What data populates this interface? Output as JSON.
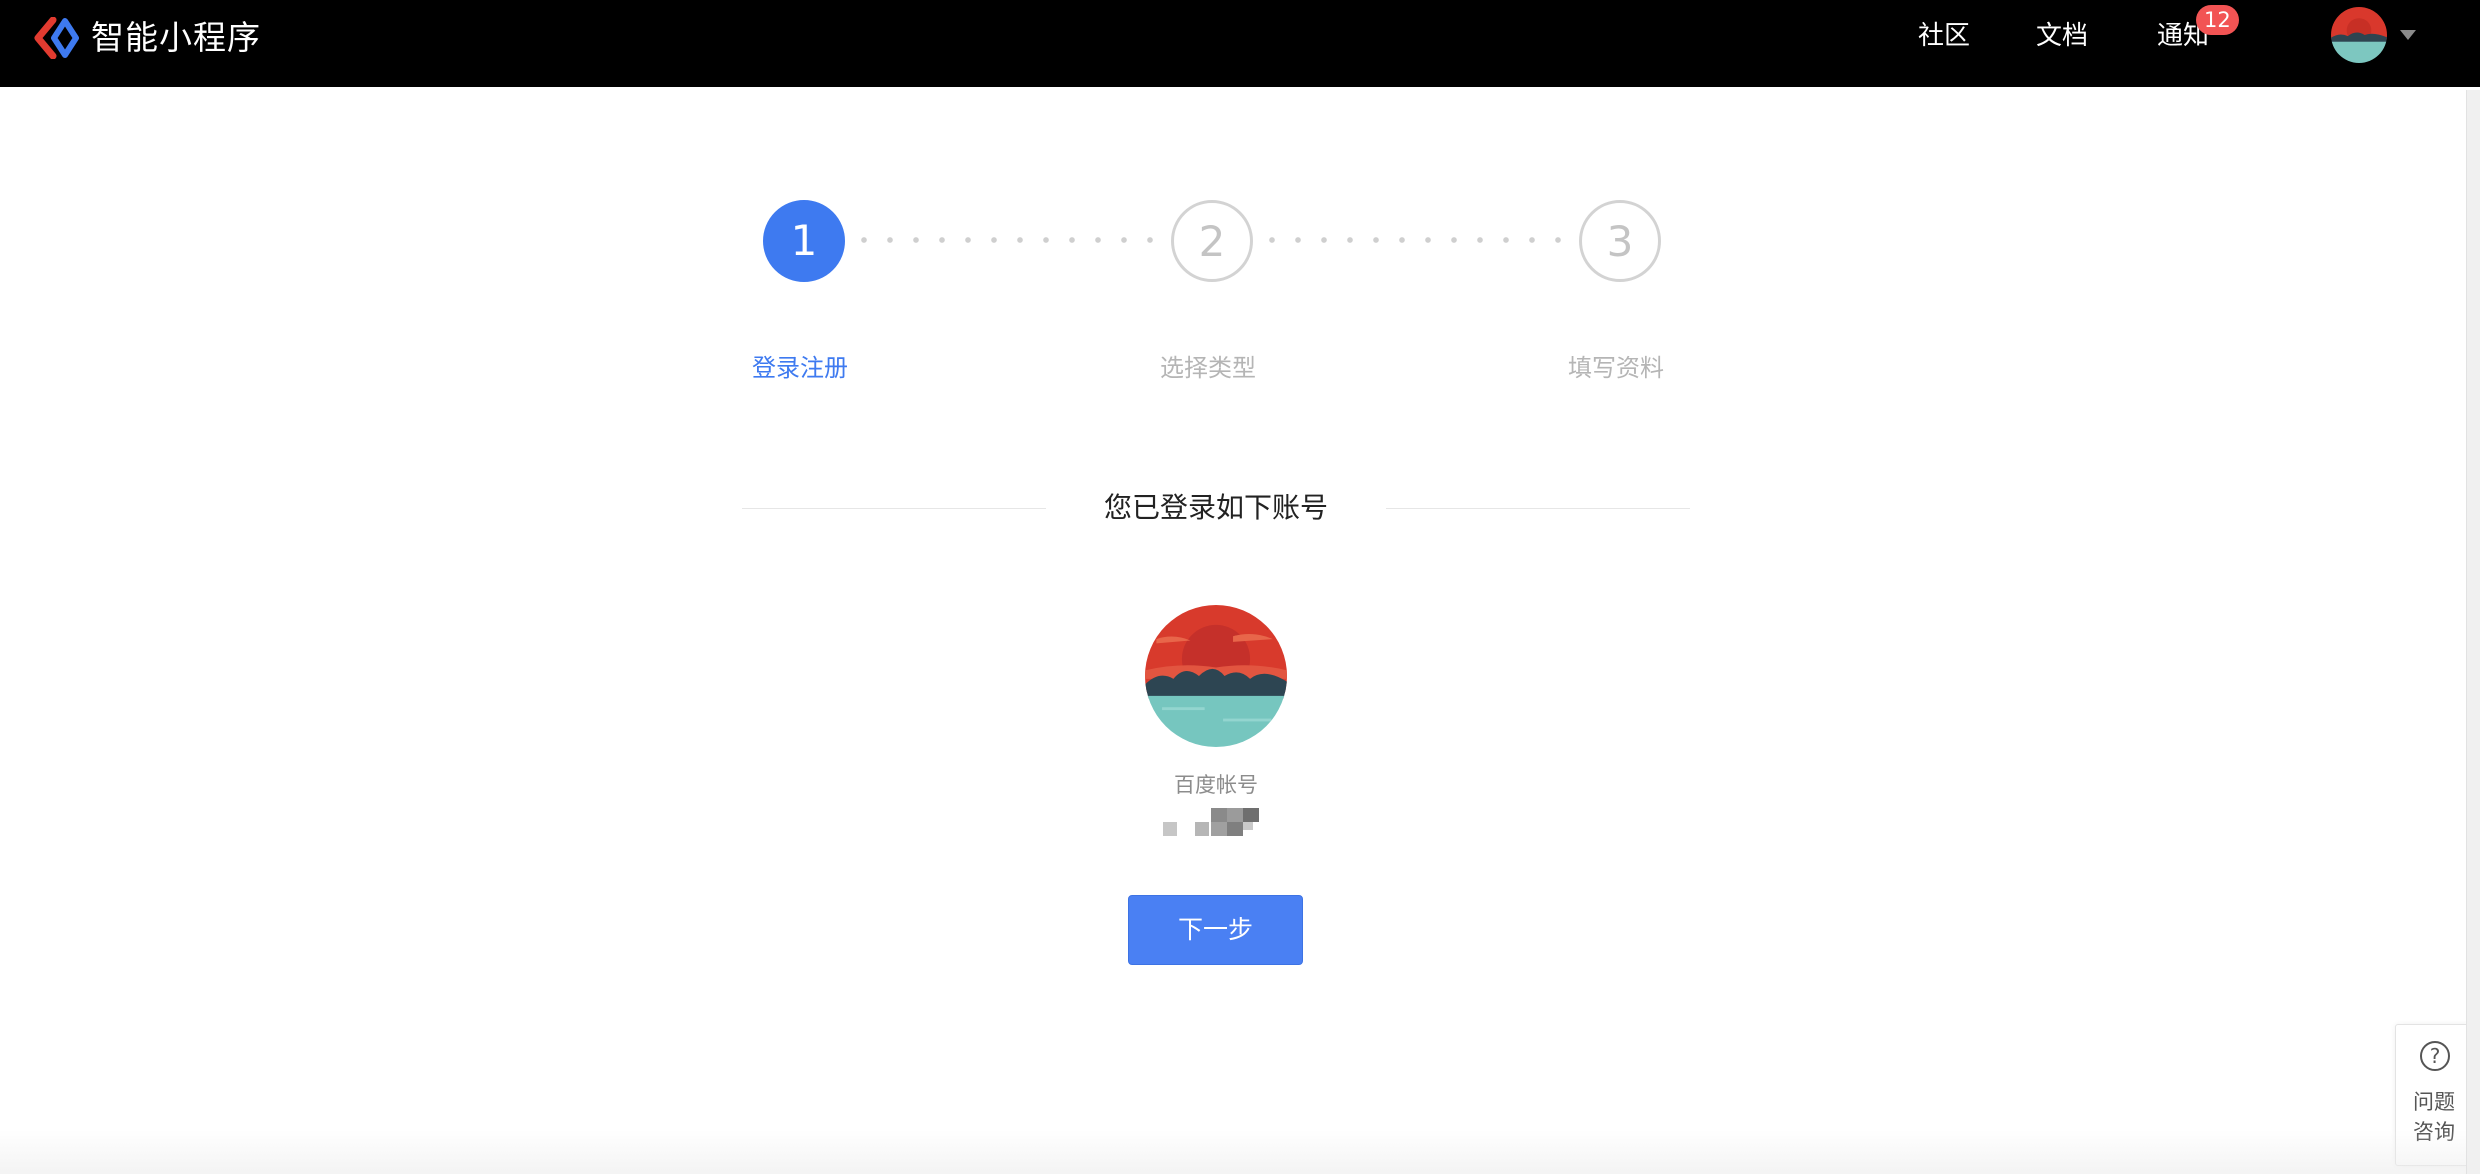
{
  "header": {
    "brand": "智能小程序",
    "nav": {
      "community": "社区",
      "docs": "文档",
      "notifications": "通知",
      "notification_count": "12"
    }
  },
  "steps": [
    {
      "number": "1",
      "label": "登录注册",
      "state": "active"
    },
    {
      "number": "2",
      "label": "选择类型",
      "state": "pending"
    },
    {
      "number": "3",
      "label": "填写资料",
      "state": "pending"
    }
  ],
  "account": {
    "title": "您已登录如下账号",
    "type_label": "百度帐号"
  },
  "actions": {
    "next": "下一步"
  },
  "help": {
    "line1": "问题",
    "line2": "咨询"
  },
  "colors": {
    "primary": "#3e7af0",
    "badge": "#f25454",
    "topbar": "#000000"
  }
}
